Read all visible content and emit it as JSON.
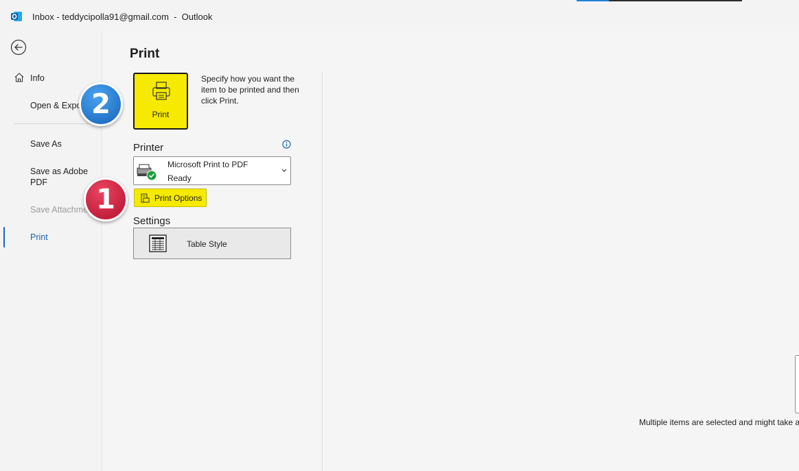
{
  "titlebar": {
    "title": "Inbox - teddycipolla91@gmail.com  -  Outlook",
    "accent_colors": [
      "#1e82d6",
      "#2b2b2b"
    ]
  },
  "sidebar": {
    "back_icon": "back-arrow-icon",
    "items": [
      {
        "label": "Info",
        "icon": "home-icon",
        "state": "normal"
      },
      {
        "label": "Open & Export",
        "state": "normal"
      },
      {
        "label": "Save As",
        "state": "normal"
      },
      {
        "label": "Save as Adobe PDF",
        "state": "normal"
      },
      {
        "label": "Save Attachments",
        "state": "disabled"
      },
      {
        "label": "Print",
        "state": "active"
      }
    ],
    "active_color": "#1763b5"
  },
  "main": {
    "page_title": "Print",
    "print_button_label": "Print",
    "print_description": "Specify how you want the item to be printed and then click Print.",
    "printer_section_label": "Printer",
    "printer": {
      "name": "Microsoft Print to PDF",
      "status": "Ready"
    },
    "print_options_label": "Print Options",
    "settings_section_label": "Settings",
    "table_style_label": "Table Style",
    "preview_message": "Multiple items are selected and might take a"
  },
  "annotations": {
    "badge_1": "1",
    "badge_2": "2",
    "highlight_color": "#f5ea00"
  }
}
